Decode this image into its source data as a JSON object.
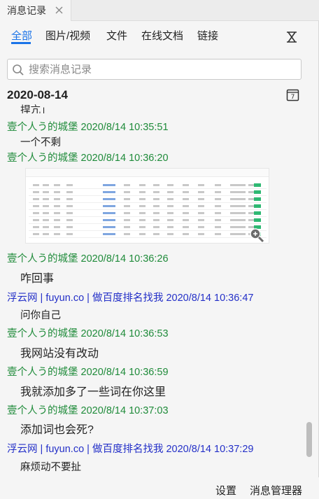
{
  "tab": {
    "title": "消息记录"
  },
  "filters": [
    {
      "label": "全部"
    },
    {
      "label": "图片/视频"
    },
    {
      "label": "文件"
    },
    {
      "label": "在线文档"
    },
    {
      "label": "链接"
    }
  ],
  "search": {
    "placeholder": "搜索消息记录"
  },
  "date": "2020-08-14",
  "messages": [
    {
      "text": "捍亢」"
    },
    {
      "sender": "壹个人う的城堡 2020/8/14 10:35:51",
      "text": "一个不剩"
    },
    {
      "sender": "壹个人う的城堡 2020/8/14 10:36:20",
      "text": ""
    },
    {
      "sender": "壹个人う的城堡 2020/8/14 10:36:26",
      "text": "咋回事"
    },
    {
      "sender": "浮云网 | fuyun.co | 做百度排名找我 2020/8/14 10:36:47",
      "text": "问你自己"
    },
    {
      "sender": "壹个人う的城堡 2020/8/14 10:36:53",
      "text": "我网站没有改动"
    },
    {
      "sender": "壹个人う的城堡 2020/8/14 10:36:59",
      "text": "我就添加多了一些词在你这里"
    },
    {
      "sender": "壹个人う的城堡 2020/8/14 10:37:03",
      "text": "添加词也会死?"
    },
    {
      "sender": "浮云网 | fuyun.co | 做百度排名找我 2020/8/14 10:37:29",
      "text": "麻烦动不要扯"
    }
  ],
  "footer": {
    "settings": "设置",
    "manager": "消息管理器"
  },
  "colors": {
    "accent": "#1a73e8",
    "sender_self": "#1f8b3a",
    "sender_other": "#2430c8"
  }
}
